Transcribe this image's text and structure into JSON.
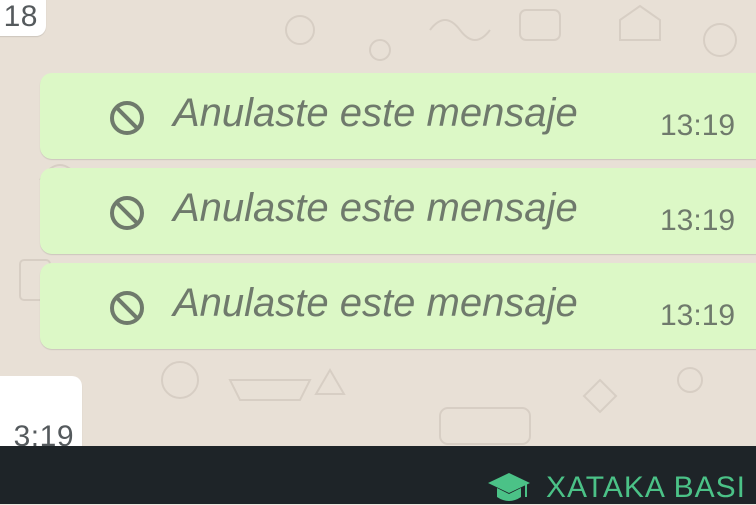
{
  "chat": {
    "incoming_top_time": "18",
    "incoming_bottom_time": "3:19",
    "messages": [
      {
        "text": "Anulaste este mensaje",
        "time": "13:19",
        "icon": "blocked-icon"
      },
      {
        "text": "Anulaste este mensaje",
        "time": "13:19",
        "icon": "blocked-icon"
      },
      {
        "text": "Anulaste este mensaje",
        "time": "13:19",
        "icon": "blocked-icon"
      }
    ]
  },
  "brand": {
    "name": "XATAKA BASI",
    "icon": "graduation-cap-icon",
    "color": "#4bc287"
  },
  "colors": {
    "outgoing_bubble": "#dcf8c6",
    "incoming_bubble": "#ffffff",
    "chat_background": "#e8e0d6",
    "footer_background": "#1e2428"
  }
}
